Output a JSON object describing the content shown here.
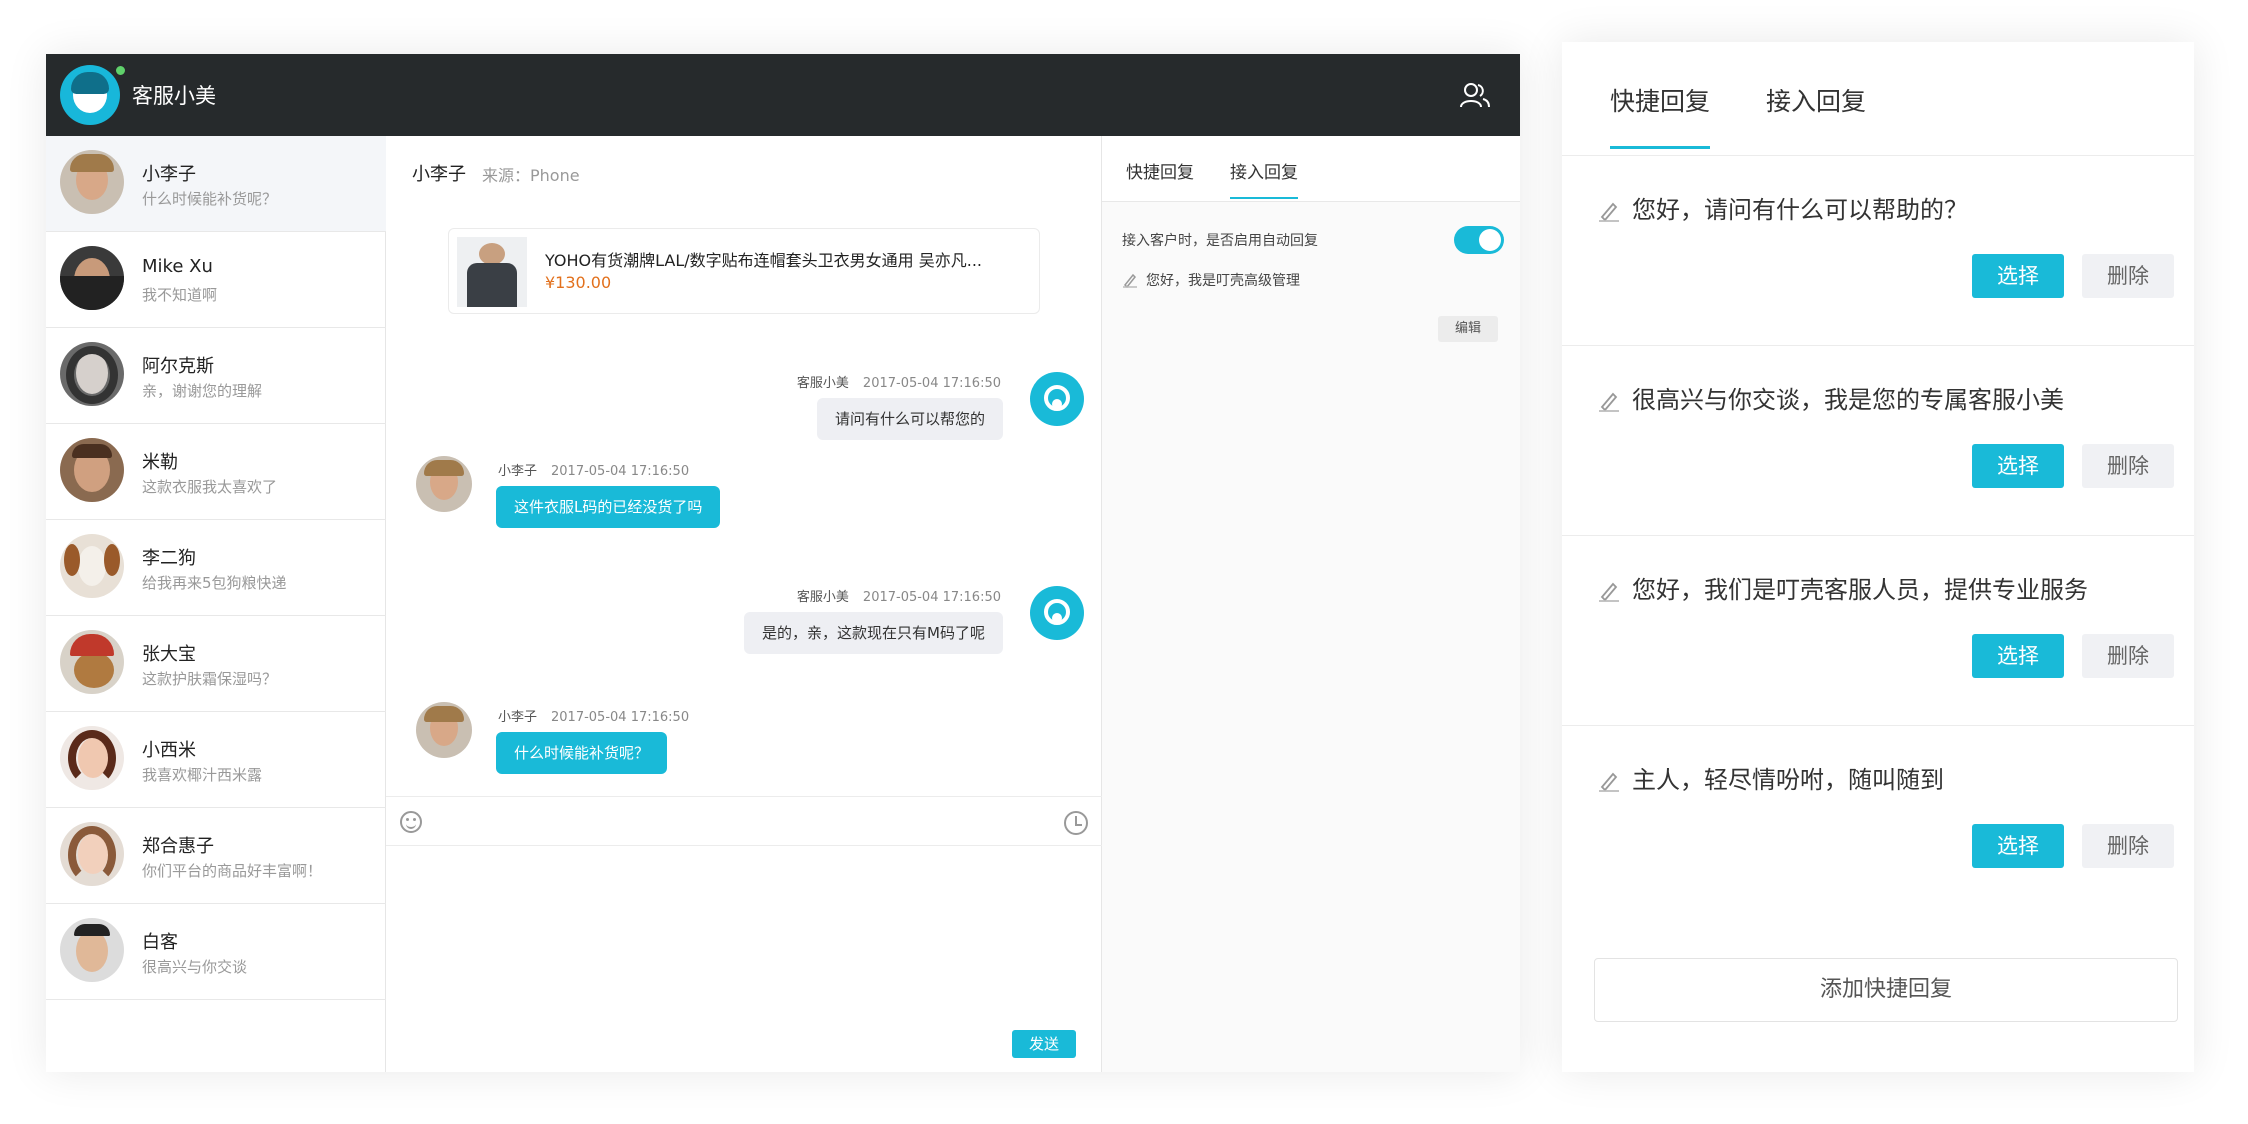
{
  "app": {
    "title": "客服小美",
    "accent": "#19bad8",
    "topbar_color": "#262a2c"
  },
  "contacts": [
    {
      "name": "小李子",
      "message": "什么时候能补货呢？"
    },
    {
      "name": "Mike Xu",
      "message": "我不知道啊"
    },
    {
      "name": "阿尔克斯",
      "message": "亲，谢谢您的理解"
    },
    {
      "name": "米勒",
      "message": "这款衣服我太喜欢了"
    },
    {
      "name": "李二狗",
      "message": "给我再来5包狗粮快递"
    },
    {
      "name": "张大宝",
      "message": "这款护肤霜保湿吗？"
    },
    {
      "name": "小西米",
      "message": "我喜欢椰汁西米露"
    },
    {
      "name": "郑合惠子",
      "message": "你们平台的商品好丰富啊！"
    },
    {
      "name": "白客",
      "message": "很高兴与你交谈"
    }
  ],
  "chat": {
    "contact_name": "小李子",
    "source": "来源：Phone",
    "product": {
      "title": "YOHO有货潮牌LAL/数字贴布连帽套头卫衣男女通用 吴亦凡...",
      "price": "¥130.00"
    },
    "messages": [
      {
        "sender": "客服小美",
        "time": "2017-05-04  17:16:50",
        "text": "请问有什么可以帮您的"
      },
      {
        "sender": "小李子",
        "time": "2017-05-04  17:16:50",
        "text": "这件衣服L码的已经没货了吗"
      },
      {
        "sender": "客服小美",
        "time": "2017-05-04  17:16:50",
        "text": "是的，亲，这款现在只有M码了呢"
      },
      {
        "sender": "小李子",
        "time": "2017-05-04  17:16:50",
        "text": "什么时候能补货呢？"
      }
    ],
    "send_label": "发送"
  },
  "right_panel": {
    "tabs": [
      "快捷回复",
      "接入回复"
    ],
    "active_tab": "接入回复",
    "auto_reply_label": "接入客户时，是否启用自动回复",
    "auto_reply_enabled": true,
    "auto_reply_text": "您好，我是叮壳高级管理",
    "edit_label": "编辑"
  },
  "quick_panel": {
    "tabs": [
      "快捷回复",
      "接入回复"
    ],
    "active_tab": "快捷回复",
    "items": [
      {
        "text": "您好，请问有什么可以帮助的？"
      },
      {
        "text": "很高兴与你交谈，我是您的专属客服小美"
      },
      {
        "text": "您好，我们是叮壳客服人员，提供专业服务"
      },
      {
        "text": "主人，轻尽情吩咐，随叫随到"
      }
    ],
    "select_label": "选择",
    "delete_label": "删除",
    "add_label": "添加快捷回复"
  }
}
